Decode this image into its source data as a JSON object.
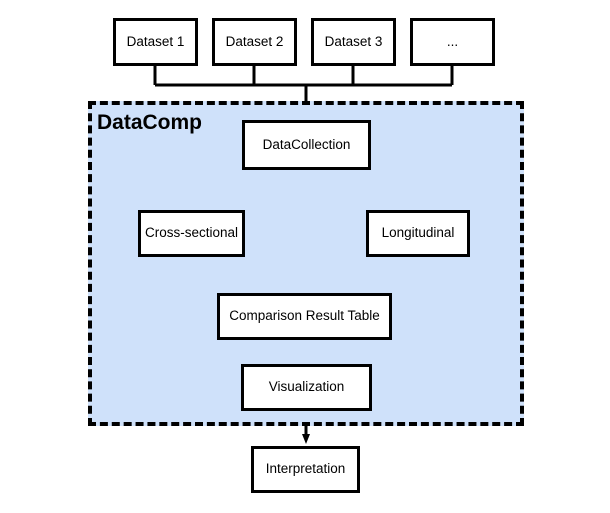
{
  "diagram": {
    "title": "DataComp pipeline flowchart",
    "colors": {
      "group_fill": "#cfe1fa",
      "group_border": "#000000",
      "node_fill": "#ffffff",
      "node_border": "#000000",
      "edge": "#000000",
      "background": "#ffffff"
    },
    "group": {
      "label": "DataComp",
      "border_style": "dashed"
    },
    "sources": [
      {
        "id": "dataset-1",
        "label": "Dataset 1"
      },
      {
        "id": "dataset-2",
        "label": "Dataset 2"
      },
      {
        "id": "dataset-3",
        "label": "Dataset 3"
      },
      {
        "id": "dataset-more",
        "label": "..."
      }
    ],
    "nodes": [
      {
        "id": "data-collection",
        "label": "DataCollection"
      },
      {
        "id": "cross-sectional",
        "label": "Cross-sectional"
      },
      {
        "id": "longitudinal",
        "label": "Longitudinal"
      },
      {
        "id": "comparison-result-table",
        "label": "Comparison Result Table"
      },
      {
        "id": "visualization",
        "label": "Visualization"
      },
      {
        "id": "interpretation",
        "label": "Interpretation"
      }
    ],
    "edges": [
      {
        "from": "dataset-1",
        "to": "data-collection"
      },
      {
        "from": "dataset-2",
        "to": "data-collection"
      },
      {
        "from": "dataset-3",
        "to": "data-collection"
      },
      {
        "from": "dataset-more",
        "to": "data-collection"
      },
      {
        "from": "data-collection",
        "to": "cross-sectional"
      },
      {
        "from": "data-collection",
        "to": "longitudinal"
      },
      {
        "from": "cross-sectional",
        "to": "comparison-result-table"
      },
      {
        "from": "longitudinal",
        "to": "comparison-result-table"
      },
      {
        "from": "comparison-result-table",
        "to": "visualization"
      },
      {
        "from": "visualization",
        "to": "interpretation"
      }
    ]
  }
}
